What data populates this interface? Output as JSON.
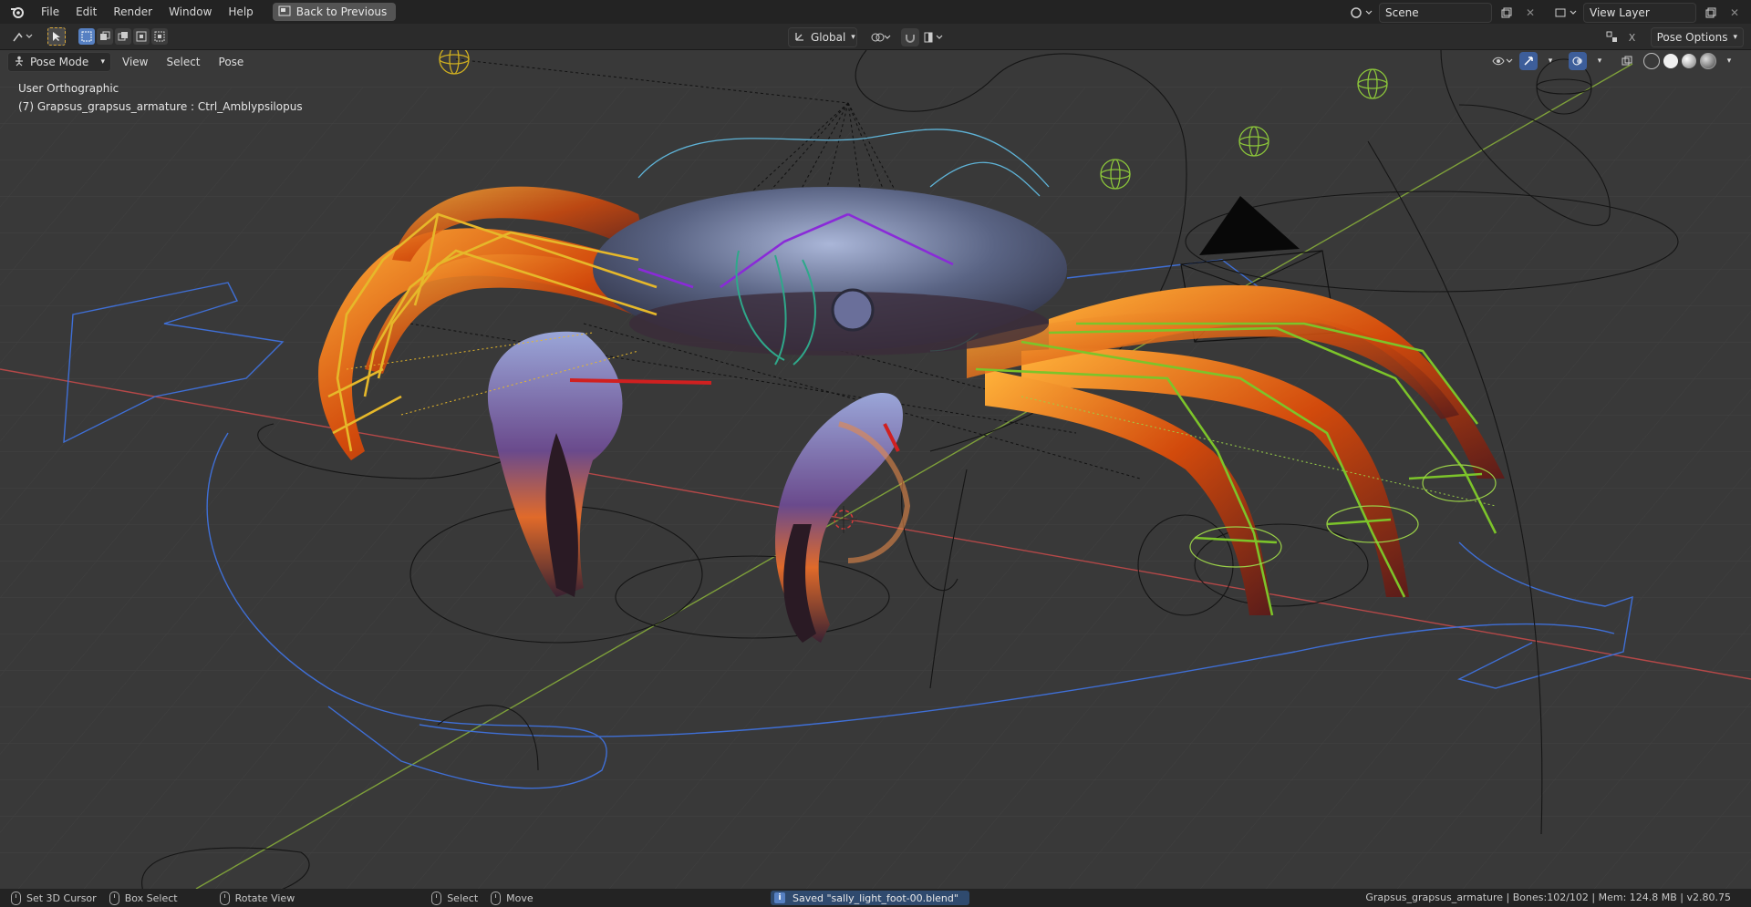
{
  "topbar": {
    "menus": [
      "File",
      "Edit",
      "Render",
      "Window",
      "Help"
    ],
    "back_button": "Back to Previous",
    "scene_name": "Scene",
    "view_layer": "View Layer"
  },
  "toolbar": {
    "orientation": "Global",
    "options": "Pose Options"
  },
  "viewport": {
    "mode": "Pose Mode",
    "menus": [
      "View",
      "Select",
      "Pose"
    ],
    "view_name": "User Orthographic",
    "active_object": "(7) Grapsus_grapsus_armature : Ctrl_Amblypsilopus"
  },
  "statusbar": {
    "items": [
      "Set 3D Cursor",
      "Box Select",
      "Rotate View",
      "Select",
      "Move"
    ],
    "message": "Saved \"sally_light_foot-00.blend\"",
    "stats": "Grapsus_grapsus_armature | Bones:102/102 | Mem: 124.8 MB | v2.80.75"
  },
  "colors": {
    "accent": "#5680c2",
    "grid_x": "#b54848",
    "grid_y": "#7ea03a",
    "bone_yellow": "#e6b82a",
    "bone_green": "#7cc42a",
    "curve_blue": "#3f6fd6"
  },
  "icons": {
    "logo": "blender-icon",
    "back": "fullscreen-exit-icon"
  }
}
